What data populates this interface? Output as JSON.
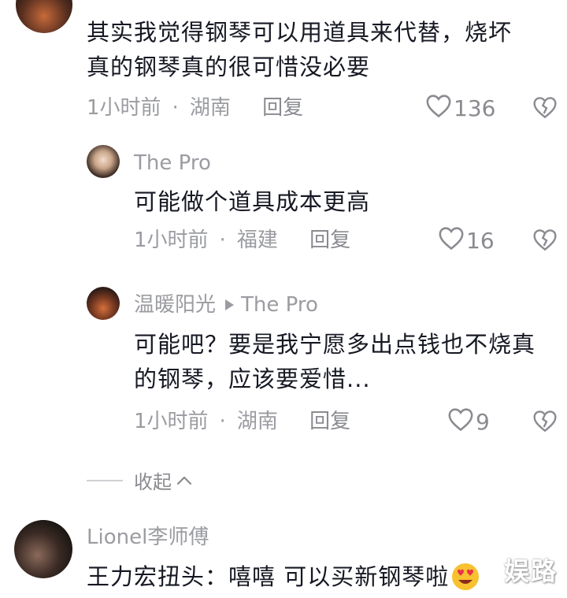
{
  "comments": [
    {
      "text_line1": "其实我觉得钢琴可以用道具来代替，烧坏",
      "text_line2": "真的钢琴真的很可惜没必要",
      "time": "1小时前",
      "dot": "·",
      "location": "湖南",
      "reply_label": "回复",
      "likes": "136"
    },
    {
      "name": "The Pro",
      "text": "可能做个道具成本更高",
      "time": "1小时前",
      "dot": "·",
      "location": "福建",
      "reply_label": "回复",
      "likes": "16"
    },
    {
      "name": "温暖阳光",
      "reply_to": "The Pro",
      "text_line1": "可能吧？要是我宁愿多出点钱也不烧真",
      "text_line2": "的钢琴，应该要爱惜...",
      "time": "1小时前",
      "dot": "·",
      "location": "湖南",
      "reply_label": "回复",
      "likes": "9"
    }
  ],
  "collapse_label": "收起",
  "bottom_comment": {
    "name": "Lionel李师傅",
    "text": "王力宏扭头：嘻嘻 可以买新钢琴啦"
  },
  "watermark": "娱路",
  "icons": {
    "like": "heart-outline-icon",
    "dislike": "broken-heart-icon",
    "collapse": "chevron-up-icon",
    "reply_arrow": "play-triangle-icon",
    "emoji": "heart-eyes-emoji-icon"
  }
}
